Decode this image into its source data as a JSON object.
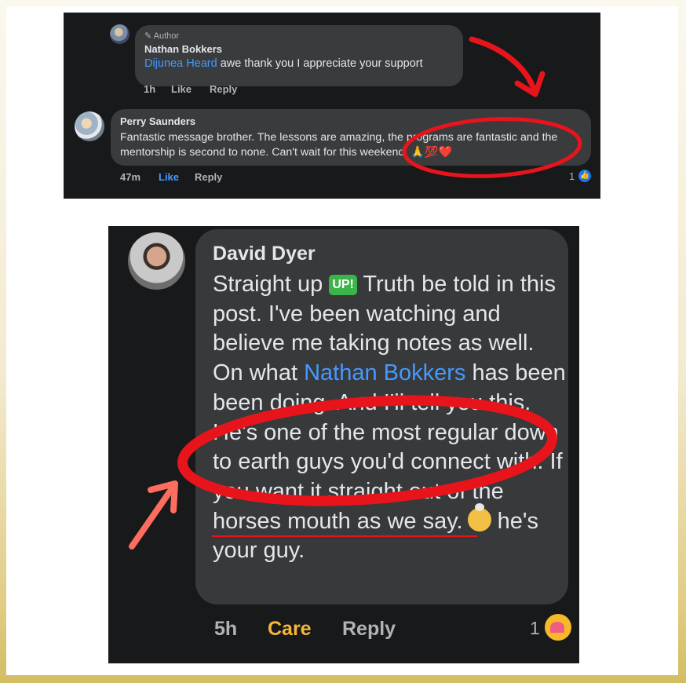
{
  "top_screenshot": {
    "author_badge": "Author",
    "comment1": {
      "name": "Nathan Bokkers",
      "mention": "Dijunea Heard",
      "text": " awe thank you I appreciate your support",
      "time": "1h",
      "like": "Like",
      "reply": "Reply"
    },
    "comment2": {
      "name": "Perry Saunders",
      "text": "Fantastic message brother. The lessons are amazing, the programs are fantastic and the mentorship is second to none. Can't wait for this weekend. 🙏💯❤️",
      "time": "47m",
      "like": "Like",
      "reply": "Reply",
      "reaction_count": "1"
    }
  },
  "bottom_screenshot": {
    "comment": {
      "name": "David Dyer",
      "text_before_badge": "Straight up ",
      "badge": "UP!",
      "text_after_badge": " Truth be told in this post. I've been watching and believe me taking notes as well. On what ",
      "mention": "Nathan Bokkers",
      "text_after_mention": " has been been doing.  And I'll tell you this.  He's one of the most regular down to earth guys you'd connect with.  If you want it straight out of the horses mouth as we say.",
      "text_last": " he's your guy.",
      "time": "5h",
      "care": "Care",
      "reply": "Reply",
      "reaction_count": "1"
    }
  },
  "colors": {
    "dark_bg": "#18191a",
    "bubble": "#3a3b3c",
    "link": "#4599ff",
    "care": "#f6b73b",
    "annotation_red": "#e8141c"
  },
  "icons": [
    "pencil-icon",
    "like-reaction-icon",
    "care-reaction-icon",
    "shocked-face-emoji",
    "up-badge-emoji"
  ]
}
